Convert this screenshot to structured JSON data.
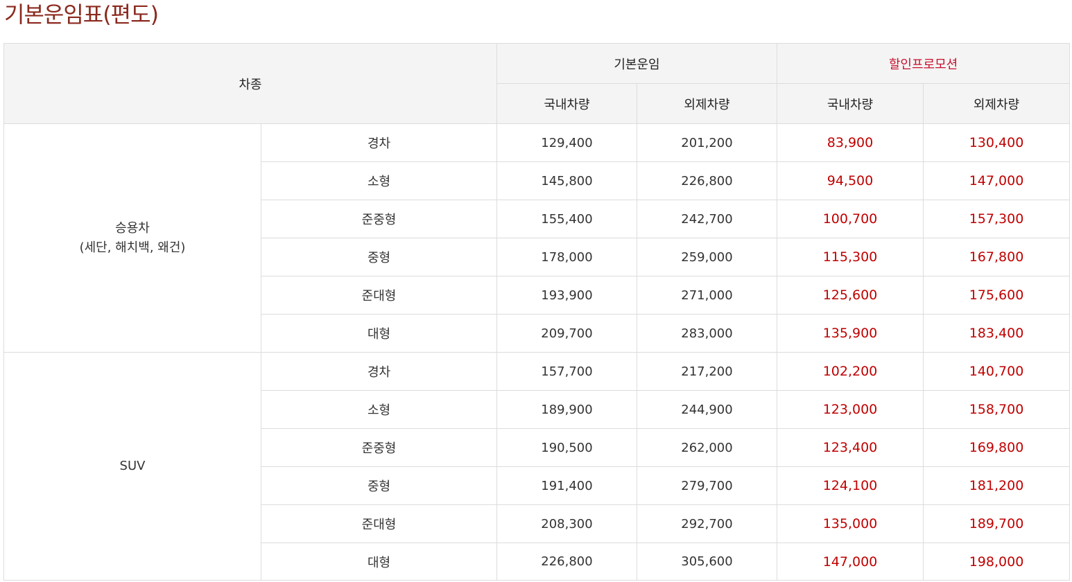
{
  "page": {
    "title": "기본운임표(편도)"
  },
  "colors": {
    "title": "#8b2a1f",
    "promo_header": "#c8102e",
    "promo_value": "#c00000",
    "header_bg": "#f4f4f4",
    "border": "#dcdcdc"
  },
  "table": {
    "headers": {
      "vehicle_type": "차종",
      "base_fare": "기본운임",
      "promotion": "할인프로모션",
      "domestic": "국내차량",
      "foreign": "외제차량"
    },
    "groups": [
      {
        "name_line1": "승용차",
        "name_line2": "(세단, 해치백, 왜건)",
        "rows": [
          {
            "size": "경차",
            "base_domestic": "129,400",
            "base_foreign": "201,200",
            "promo_domestic": "83,900",
            "promo_foreign": "130,400"
          },
          {
            "size": "소형",
            "base_domestic": "145,800",
            "base_foreign": "226,800",
            "promo_domestic": "94,500",
            "promo_foreign": "147,000"
          },
          {
            "size": "준중형",
            "base_domestic": "155,400",
            "base_foreign": "242,700",
            "promo_domestic": "100,700",
            "promo_foreign": "157,300"
          },
          {
            "size": "중형",
            "base_domestic": "178,000",
            "base_foreign": "259,000",
            "promo_domestic": "115,300",
            "promo_foreign": "167,800"
          },
          {
            "size": "준대형",
            "base_domestic": "193,900",
            "base_foreign": "271,000",
            "promo_domestic": "125,600",
            "promo_foreign": "175,600"
          },
          {
            "size": "대형",
            "base_domestic": "209,700",
            "base_foreign": "283,000",
            "promo_domestic": "135,900",
            "promo_foreign": "183,400"
          }
        ]
      },
      {
        "name_line1": "SUV",
        "name_line2": "",
        "rows": [
          {
            "size": "경차",
            "base_domestic": "157,700",
            "base_foreign": "217,200",
            "promo_domestic": "102,200",
            "promo_foreign": "140,700"
          },
          {
            "size": "소형",
            "base_domestic": "189,900",
            "base_foreign": "244,900",
            "promo_domestic": "123,000",
            "promo_foreign": "158,700"
          },
          {
            "size": "준중형",
            "base_domestic": "190,500",
            "base_foreign": "262,000",
            "promo_domestic": "123,400",
            "promo_foreign": "169,800"
          },
          {
            "size": "중형",
            "base_domestic": "191,400",
            "base_foreign": "279,700",
            "promo_domestic": "124,100",
            "promo_foreign": "181,200"
          },
          {
            "size": "준대형",
            "base_domestic": "208,300",
            "base_foreign": "292,700",
            "promo_domestic": "135,000",
            "promo_foreign": "189,700"
          },
          {
            "size": "대형",
            "base_domestic": "226,800",
            "base_foreign": "305,600",
            "promo_domestic": "147,000",
            "promo_foreign": "198,000"
          }
        ]
      }
    ]
  }
}
